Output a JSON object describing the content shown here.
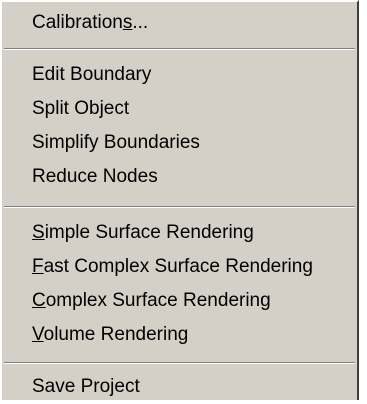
{
  "menu": {
    "groups": [
      {
        "items": [
          {
            "pre": "Calibration",
            "key": "s",
            "post": "..."
          }
        ]
      },
      {
        "items": [
          {
            "pre": "",
            "key": "",
            "post": "Edit Boundary"
          },
          {
            "pre": "",
            "key": "",
            "post": "Split Object"
          },
          {
            "pre": "",
            "key": "",
            "post": "Simplify Boundaries"
          },
          {
            "pre": "",
            "key": "",
            "post": "Reduce Nodes"
          }
        ]
      },
      {
        "items": [
          {
            "pre": "",
            "key": "S",
            "post": "imple Surface Rendering"
          },
          {
            "pre": "",
            "key": "F",
            "post": "ast Complex Surface Rendering"
          },
          {
            "pre": "",
            "key": "C",
            "post": "omplex Surface Rendering"
          },
          {
            "pre": "",
            "key": "V",
            "post": "olume Rendering"
          }
        ]
      },
      {
        "items": [
          {
            "pre": "",
            "key": "",
            "post": "Save Project"
          }
        ]
      }
    ]
  }
}
